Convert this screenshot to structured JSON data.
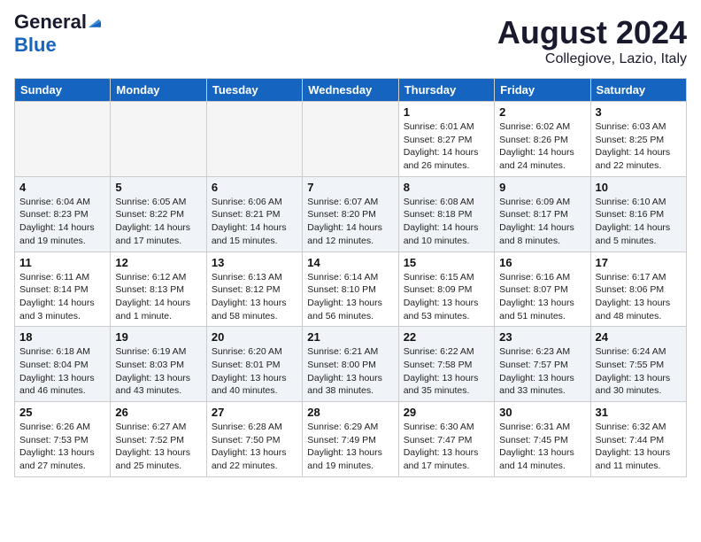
{
  "header": {
    "logo_general": "General",
    "logo_blue": "Blue",
    "month_year": "August 2024",
    "location": "Collegiove, Lazio, Italy"
  },
  "days_of_week": [
    "Sunday",
    "Monday",
    "Tuesday",
    "Wednesday",
    "Thursday",
    "Friday",
    "Saturday"
  ],
  "weeks": [
    [
      {
        "day": "",
        "info": ""
      },
      {
        "day": "",
        "info": ""
      },
      {
        "day": "",
        "info": ""
      },
      {
        "day": "",
        "info": ""
      },
      {
        "day": "1",
        "info": "Sunrise: 6:01 AM\nSunset: 8:27 PM\nDaylight: 14 hours\nand 26 minutes."
      },
      {
        "day": "2",
        "info": "Sunrise: 6:02 AM\nSunset: 8:26 PM\nDaylight: 14 hours\nand 24 minutes."
      },
      {
        "day": "3",
        "info": "Sunrise: 6:03 AM\nSunset: 8:25 PM\nDaylight: 14 hours\nand 22 minutes."
      }
    ],
    [
      {
        "day": "4",
        "info": "Sunrise: 6:04 AM\nSunset: 8:23 PM\nDaylight: 14 hours\nand 19 minutes."
      },
      {
        "day": "5",
        "info": "Sunrise: 6:05 AM\nSunset: 8:22 PM\nDaylight: 14 hours\nand 17 minutes."
      },
      {
        "day": "6",
        "info": "Sunrise: 6:06 AM\nSunset: 8:21 PM\nDaylight: 14 hours\nand 15 minutes."
      },
      {
        "day": "7",
        "info": "Sunrise: 6:07 AM\nSunset: 8:20 PM\nDaylight: 14 hours\nand 12 minutes."
      },
      {
        "day": "8",
        "info": "Sunrise: 6:08 AM\nSunset: 8:18 PM\nDaylight: 14 hours\nand 10 minutes."
      },
      {
        "day": "9",
        "info": "Sunrise: 6:09 AM\nSunset: 8:17 PM\nDaylight: 14 hours\nand 8 minutes."
      },
      {
        "day": "10",
        "info": "Sunrise: 6:10 AM\nSunset: 8:16 PM\nDaylight: 14 hours\nand 5 minutes."
      }
    ],
    [
      {
        "day": "11",
        "info": "Sunrise: 6:11 AM\nSunset: 8:14 PM\nDaylight: 14 hours\nand 3 minutes."
      },
      {
        "day": "12",
        "info": "Sunrise: 6:12 AM\nSunset: 8:13 PM\nDaylight: 14 hours\nand 1 minute."
      },
      {
        "day": "13",
        "info": "Sunrise: 6:13 AM\nSunset: 8:12 PM\nDaylight: 13 hours\nand 58 minutes."
      },
      {
        "day": "14",
        "info": "Sunrise: 6:14 AM\nSunset: 8:10 PM\nDaylight: 13 hours\nand 56 minutes."
      },
      {
        "day": "15",
        "info": "Sunrise: 6:15 AM\nSunset: 8:09 PM\nDaylight: 13 hours\nand 53 minutes."
      },
      {
        "day": "16",
        "info": "Sunrise: 6:16 AM\nSunset: 8:07 PM\nDaylight: 13 hours\nand 51 minutes."
      },
      {
        "day": "17",
        "info": "Sunrise: 6:17 AM\nSunset: 8:06 PM\nDaylight: 13 hours\nand 48 minutes."
      }
    ],
    [
      {
        "day": "18",
        "info": "Sunrise: 6:18 AM\nSunset: 8:04 PM\nDaylight: 13 hours\nand 46 minutes."
      },
      {
        "day": "19",
        "info": "Sunrise: 6:19 AM\nSunset: 8:03 PM\nDaylight: 13 hours\nand 43 minutes."
      },
      {
        "day": "20",
        "info": "Sunrise: 6:20 AM\nSunset: 8:01 PM\nDaylight: 13 hours\nand 40 minutes."
      },
      {
        "day": "21",
        "info": "Sunrise: 6:21 AM\nSunset: 8:00 PM\nDaylight: 13 hours\nand 38 minutes."
      },
      {
        "day": "22",
        "info": "Sunrise: 6:22 AM\nSunset: 7:58 PM\nDaylight: 13 hours\nand 35 minutes."
      },
      {
        "day": "23",
        "info": "Sunrise: 6:23 AM\nSunset: 7:57 PM\nDaylight: 13 hours\nand 33 minutes."
      },
      {
        "day": "24",
        "info": "Sunrise: 6:24 AM\nSunset: 7:55 PM\nDaylight: 13 hours\nand 30 minutes."
      }
    ],
    [
      {
        "day": "25",
        "info": "Sunrise: 6:26 AM\nSunset: 7:53 PM\nDaylight: 13 hours\nand 27 minutes."
      },
      {
        "day": "26",
        "info": "Sunrise: 6:27 AM\nSunset: 7:52 PM\nDaylight: 13 hours\nand 25 minutes."
      },
      {
        "day": "27",
        "info": "Sunrise: 6:28 AM\nSunset: 7:50 PM\nDaylight: 13 hours\nand 22 minutes."
      },
      {
        "day": "28",
        "info": "Sunrise: 6:29 AM\nSunset: 7:49 PM\nDaylight: 13 hours\nand 19 minutes."
      },
      {
        "day": "29",
        "info": "Sunrise: 6:30 AM\nSunset: 7:47 PM\nDaylight: 13 hours\nand 17 minutes."
      },
      {
        "day": "30",
        "info": "Sunrise: 6:31 AM\nSunset: 7:45 PM\nDaylight: 13 hours\nand 14 minutes."
      },
      {
        "day": "31",
        "info": "Sunrise: 6:32 AM\nSunset: 7:44 PM\nDaylight: 13 hours\nand 11 minutes."
      }
    ]
  ]
}
